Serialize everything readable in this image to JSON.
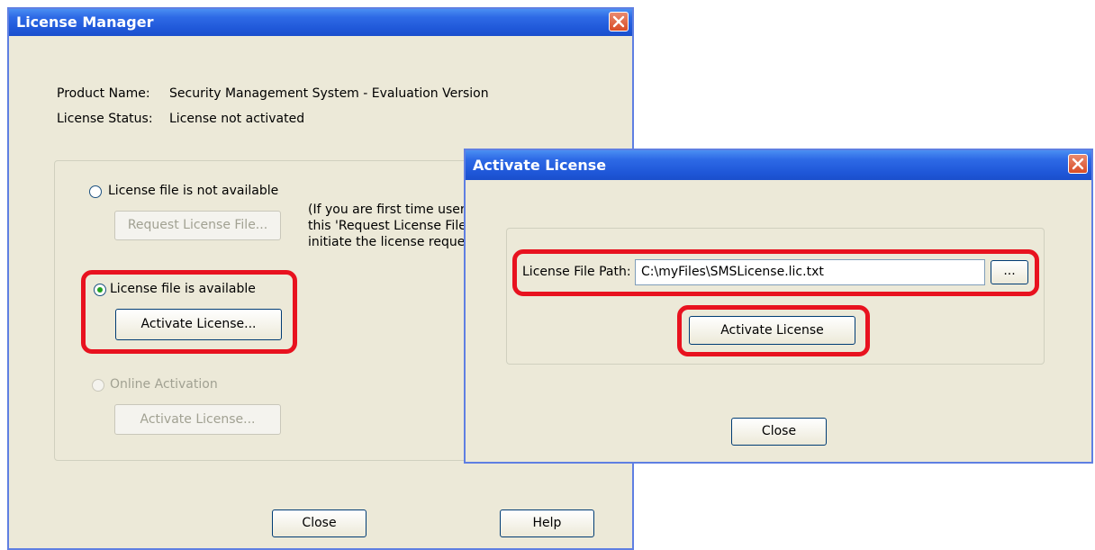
{
  "license_manager": {
    "title": "License Manager",
    "product_name_label": "Product Name:",
    "product_name_value": "Security Management System - Evaluation Version",
    "license_status_label": "License Status:",
    "license_status_value": "License not activated",
    "options": {
      "not_available_label": "License file is not available",
      "request_button": "Request License File...",
      "hint_line1": "(If you are first time user",
      "hint_line2": "this 'Request License File",
      "hint_line3": "initiate the license reques",
      "available_label": "License file is available",
      "activate_button": "Activate License...",
      "online_label": "Online Activation",
      "online_activate_button": "Activate License..."
    },
    "close_button": "Close",
    "help_button": "Help"
  },
  "activate_dialog": {
    "title": "Activate License",
    "path_label": "License File Path:",
    "path_value": "C:\\myFiles\\SMSLicense.lic.txt",
    "browse_button": "...",
    "activate_button": "Activate License",
    "close_button": "Close"
  },
  "colors": {
    "highlight": "#e8121f",
    "title_bar": "#2e6ae6",
    "window_bg": "#ece9d8"
  }
}
